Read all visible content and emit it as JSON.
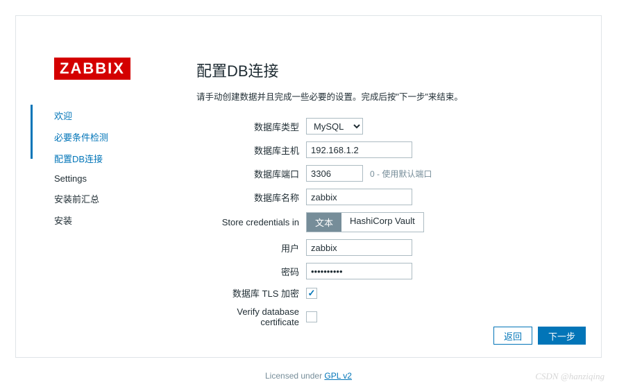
{
  "logo": "ZABBIX",
  "sidebar": {
    "items": [
      {
        "label": "欢迎",
        "state": "done"
      },
      {
        "label": "必要条件检测",
        "state": "done"
      },
      {
        "label": "配置DB连接",
        "state": "active"
      },
      {
        "label": "Settings",
        "state": "pending"
      },
      {
        "label": "安装前汇总",
        "state": "pending"
      },
      {
        "label": "安装",
        "state": "pending"
      }
    ]
  },
  "main": {
    "title": "配置DB连接",
    "desc": "请手动创建数据并且完成一些必要的设置。完成后按\"下一步\"来结束。"
  },
  "form": {
    "db_type": {
      "label": "数据库类型",
      "value": "MySQL",
      "options": [
        "MySQL"
      ]
    },
    "db_host": {
      "label": "数据库主机",
      "value": "192.168.1.2"
    },
    "db_port": {
      "label": "数据库端口",
      "value": "3306",
      "hint": "0 - 使用默认端口"
    },
    "db_name": {
      "label": "数据库名称",
      "value": "zabbix"
    },
    "store": {
      "label": "Store credentials in",
      "options": [
        "文本",
        "HashiCorp Vault"
      ],
      "selected": 0
    },
    "user": {
      "label": "用户",
      "value": "zabbix"
    },
    "password": {
      "label": "密码",
      "value": "••••••••••"
    },
    "tls": {
      "label": "数据库 TLS 加密",
      "checked": true
    },
    "verify": {
      "label": "Verify database certificate",
      "checked": false
    }
  },
  "buttons": {
    "back": "返回",
    "next": "下一步"
  },
  "license": {
    "prefix": "Licensed under ",
    "link": "GPL v2"
  },
  "watermark": "CSDN @hanziqing"
}
